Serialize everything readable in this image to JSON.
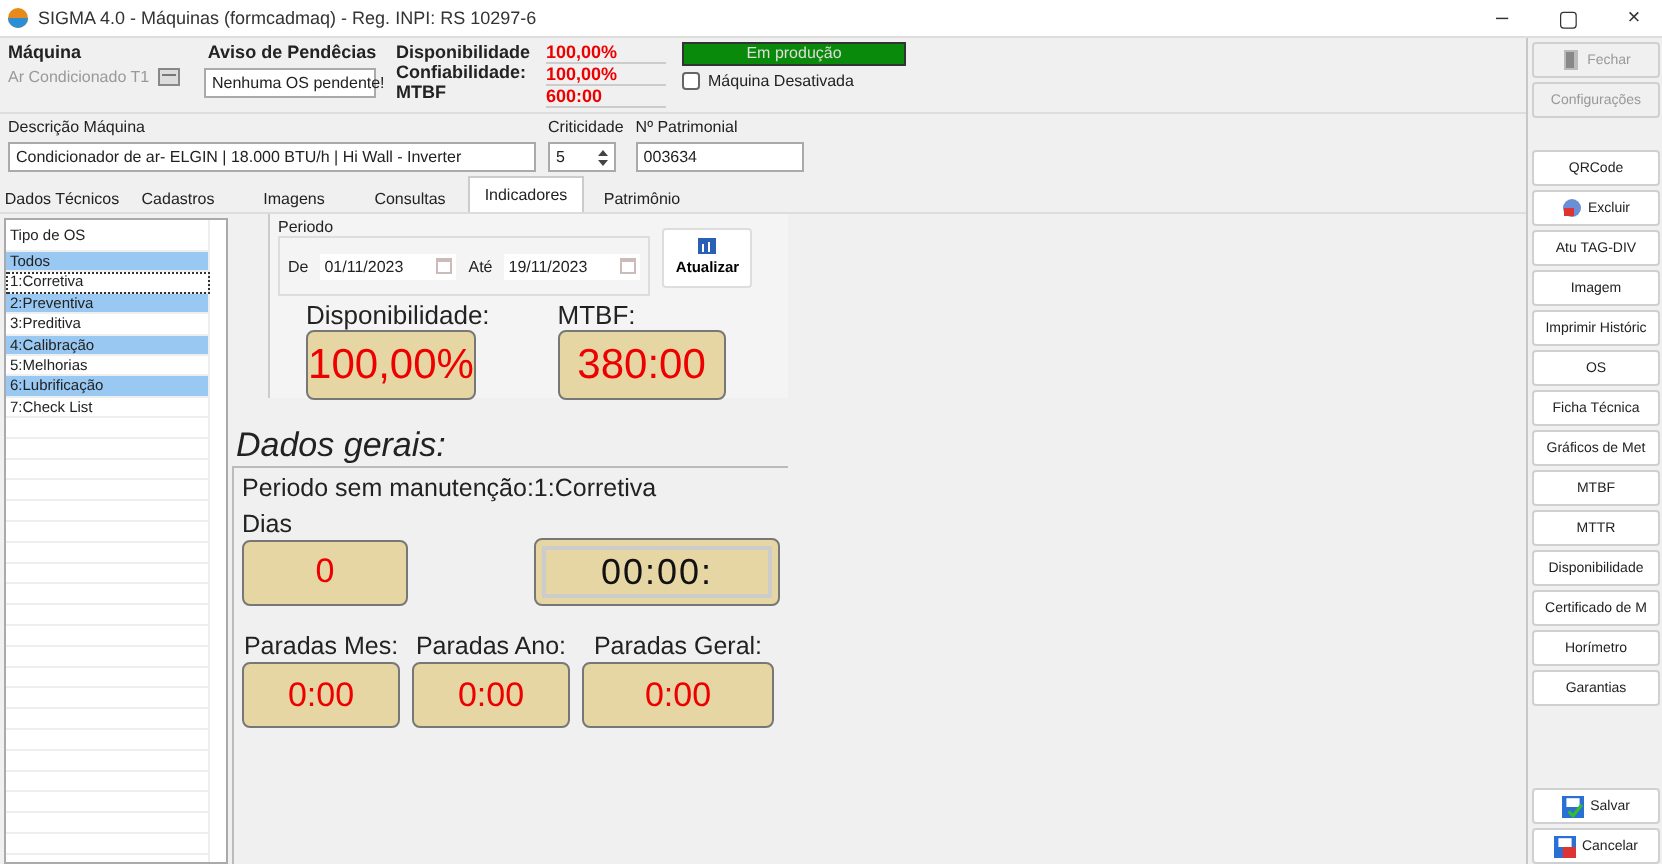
{
  "window": {
    "title": "SIGMA 4.0 - Máquinas  (formcadmaq)  - Reg. INPI: RS 10297-6",
    "controls": [
      "–",
      "▢",
      "×"
    ]
  },
  "header": {
    "machine_label": "Máquina",
    "machine_value": "Ar Condicionado T1",
    "pending_label": "Aviso de Pendêcias",
    "pending_value": "Nenhuma OS pendente!",
    "stats": [
      {
        "label": "Disponibilidade",
        "value": "100,00%"
      },
      {
        "label": "Confiabilidade:",
        "value": "100,00%"
      },
      {
        "label": "MTBF",
        "value": "600:00"
      }
    ],
    "status": "Em produção",
    "deactivated": {
      "label": "Máquina Desativada",
      "checked": false
    }
  },
  "details": {
    "description_label": "Descrição Máquina",
    "description": "Condicionador de ar- ELGIN | 18.000 BTU/h | Hi Wall - Inverter",
    "criticality_label": "Criticidade",
    "criticality": "5",
    "asset_label": "Nº Patrimonial",
    "asset": "003634"
  },
  "tabs": [
    {
      "label": "Dados Técnicos",
      "selected": false
    },
    {
      "label": "Cadastros",
      "selected": false
    },
    {
      "label": "Imagens",
      "selected": false
    },
    {
      "label": "Consultas",
      "selected": false
    },
    {
      "label": "Indicadores",
      "selected": true
    },
    {
      "label": "Patrimônio",
      "selected": false
    }
  ],
  "os_types": {
    "header": "Tipo de OS",
    "items": [
      {
        "label": "Todos",
        "selected": true,
        "focused": false
      },
      {
        "label": "1:Corretiva",
        "selected": false,
        "focused": true
      },
      {
        "label": "2:Preventiva",
        "selected": true,
        "focused": false
      },
      {
        "label": "3:Preditiva",
        "selected": false,
        "focused": false
      },
      {
        "label": "4:Calibração",
        "selected": true,
        "focused": false
      },
      {
        "label": "5:Melhorias",
        "selected": false,
        "focused": false
      },
      {
        "label": "6:Lubrificação",
        "selected": true,
        "focused": false
      },
      {
        "label": "7:Check List",
        "selected": false,
        "focused": false
      }
    ]
  },
  "period": {
    "label": "Periodo",
    "from_label": "De",
    "from": "01/11/2023",
    "to_label": "Até",
    "to": "19/11/2023",
    "refresh": "Atualizar"
  },
  "indicators": [
    {
      "label": "Disponibilidade:",
      "value": "100,00%"
    },
    {
      "label": "MTBF:",
      "value": "380:00"
    }
  ],
  "general": {
    "title": "Dados gerais:",
    "period_text": "Periodo sem manutenção:1:Corretiva",
    "days_label": "Dias",
    "days": "0",
    "time": "00:00:",
    "stops": [
      {
        "label": "Paradas Mes:",
        "value": "0:00"
      },
      {
        "label": "Paradas Ano:",
        "value": "0:00"
      },
      {
        "label": "Paradas Geral:",
        "value": "0:00"
      }
    ]
  },
  "sidebar": {
    "top": [
      {
        "label": "Fechar",
        "kind": "door",
        "disabled": true
      },
      {
        "label": "Configurações",
        "kind": "plain",
        "disabled": true
      }
    ],
    "buttons": [
      {
        "label": "QRCode",
        "kind": "plain"
      },
      {
        "label": "Excluir",
        "kind": "delete"
      },
      {
        "label": "Atu TAG-DIV",
        "kind": "plain"
      },
      {
        "label": "Imagem",
        "kind": "plain"
      },
      {
        "label": "Imprimir Históric",
        "kind": "plain"
      },
      {
        "label": "OS",
        "kind": "plain"
      },
      {
        "label": "Ficha Técnica",
        "kind": "plain"
      },
      {
        "label": "Gráficos de Met",
        "kind": "plain"
      },
      {
        "label": "MTBF",
        "kind": "plain"
      },
      {
        "label": "MTTR",
        "kind": "plain"
      },
      {
        "label": "Disponibilidade",
        "kind": "plain"
      },
      {
        "label": "Certificado de M",
        "kind": "plain"
      },
      {
        "label": "Horímetro",
        "kind": "plain"
      },
      {
        "label": "Garantias",
        "kind": "plain"
      }
    ],
    "bottom": [
      {
        "label": "Salvar",
        "kind": "save"
      },
      {
        "label": "Cancelar",
        "kind": "cancel"
      }
    ]
  }
}
